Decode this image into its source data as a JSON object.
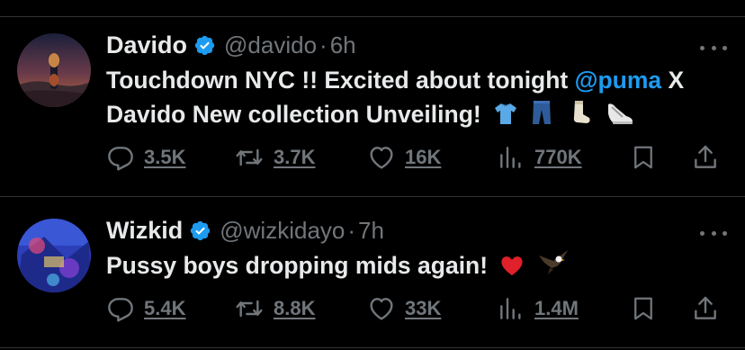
{
  "tweets": [
    {
      "name": "Davido",
      "handle": "@davido",
      "separator": "·",
      "time": "6h",
      "text_before": "Touchdown NYC !! Excited about tonight ",
      "mention": "@puma",
      "text_after": " X Davido New collection Unveiling!",
      "emojis": [
        "t-shirt-emoji",
        "jeans-emoji",
        "sock-emoji",
        "sneaker-emoji"
      ],
      "replies": "3.5K",
      "reposts": "3.7K",
      "likes": "16K",
      "views": "770K"
    },
    {
      "name": "Wizkid",
      "handle": "@wizkidayo",
      "separator": "·",
      "time": "7h",
      "text_before": "Pussy boys dropping mids again!",
      "mention": "",
      "text_after": "",
      "emojis": [
        "red-heart-emoji",
        "eagle-emoji"
      ],
      "replies": "5.4K",
      "reposts": "8.8K",
      "likes": "33K",
      "views": "1.4M"
    }
  ],
  "colors": {
    "background": "#000000",
    "text": "#e7e9ea",
    "secondary": "#71767b",
    "accent": "#1d9bf0",
    "divider": "#2f3336"
  }
}
